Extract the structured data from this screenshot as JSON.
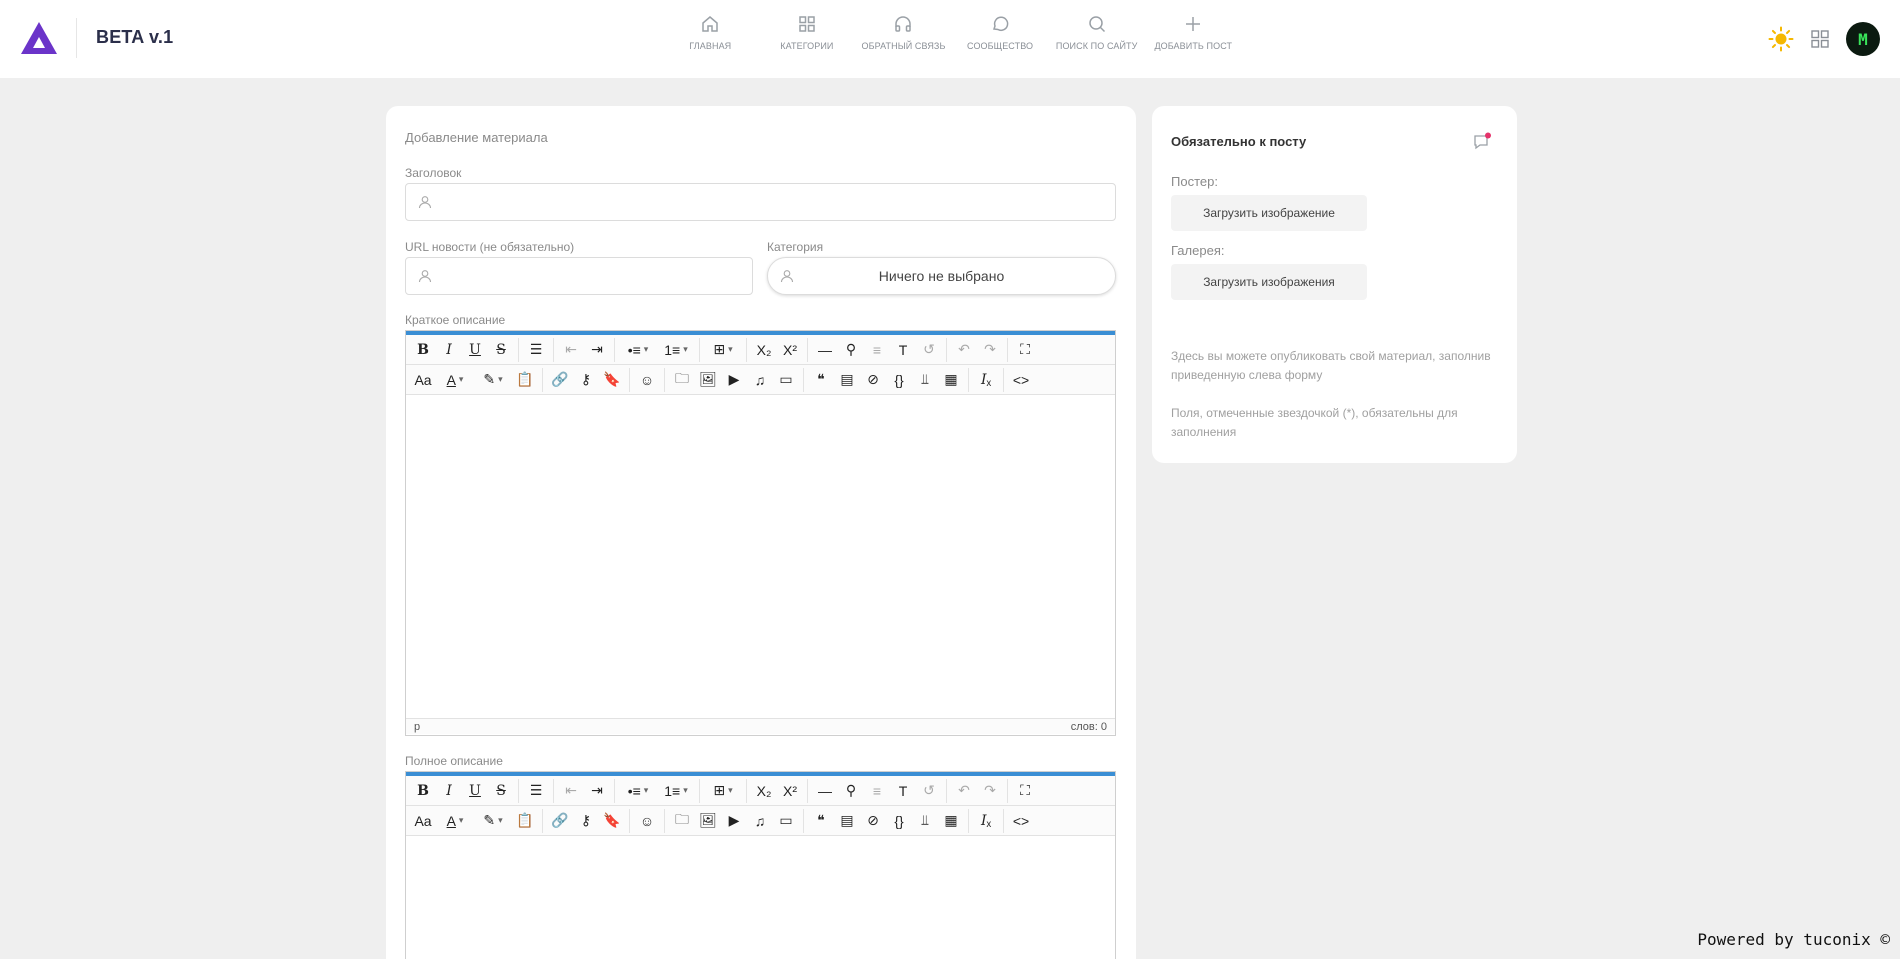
{
  "header": {
    "brand": "BETA v.1",
    "nav": [
      {
        "label": "ГЛАВНАЯ",
        "icon": "home-icon"
      },
      {
        "label": "КАТЕГОРИИ",
        "icon": "grid-icon"
      },
      {
        "label": "ОБРАТНЫЙ СВЯЗЬ",
        "icon": "headphones-icon"
      },
      {
        "label": "СООБЩЕСТВО",
        "icon": "chat-bubble-icon"
      },
      {
        "label": "ПОИСК ПО САЙТУ",
        "icon": "search-icon"
      },
      {
        "label": "ДОБАВИТЬ ПОСТ",
        "icon": "plus-icon"
      }
    ],
    "avatar_text": "M",
    "colors": {
      "logo": "#6b34c9",
      "sun": "#f5b800"
    }
  },
  "form": {
    "title": "Добавление материала",
    "title_label": "Заголовок",
    "title_value": "",
    "url_label": "URL новости (не обязательно)",
    "url_value": "",
    "category_label": "Категория",
    "category_value": "Ничего не выбрано",
    "short_label": "Краткое описание",
    "full_label": "Полное описание",
    "editor_status_path": "p",
    "editor_word_count": "слов: 0"
  },
  "side": {
    "title": "Обязательно к посту",
    "poster_label": "Постер:",
    "poster_button": "Загрузить изображение",
    "gallery_label": "Галерея:",
    "gallery_button": "Загрузить изображения",
    "info1": "Здесь вы можете опубликовать свой материал, заполнив приведенную слева форму",
    "info2": "Поля, отмеченные звездочкой (*), обязательны для заполнения"
  },
  "footer": {
    "powered": "Powered by tuconix ©"
  },
  "accent": "#3a8ed4"
}
